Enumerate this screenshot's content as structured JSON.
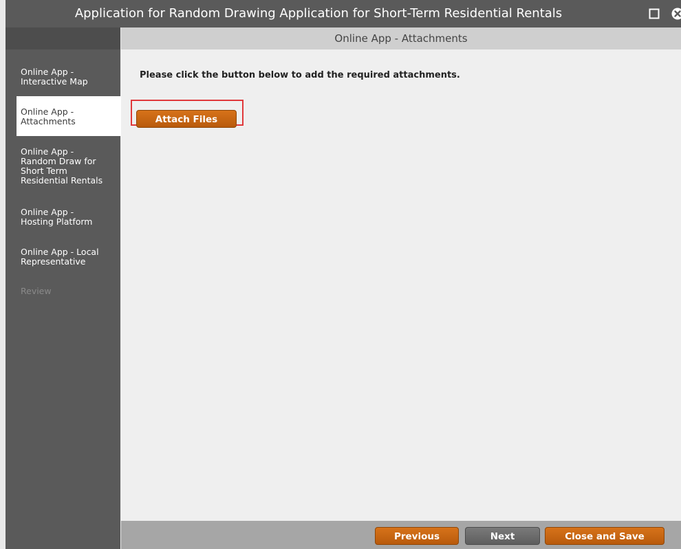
{
  "window": {
    "title": "Application for Random Drawing Application for Short-Term Residential Rentals"
  },
  "sidebar": {
    "items": [
      {
        "lines": [
          "Online App -",
          "Interactive Map"
        ],
        "state": "normal"
      },
      {
        "lines": [
          "Online App -",
          "Attachments"
        ],
        "state": "active"
      },
      {
        "lines": [
          "Online App -",
          "Random Draw for",
          "Short Term",
          "Residential Rentals"
        ],
        "state": "normal"
      },
      {
        "lines": [
          "Online App -",
          "Hosting Platform"
        ],
        "state": "normal"
      },
      {
        "lines": [
          "Online App - Local",
          "Representative"
        ],
        "state": "normal"
      },
      {
        "lines": [
          "Review"
        ],
        "state": "disabled"
      }
    ]
  },
  "main": {
    "header": "Online App - Attachments",
    "instructions": "Please click the button below to add the required attachments.",
    "attach_button": "Attach Files"
  },
  "footer": {
    "previous": "Previous",
    "next": "Next",
    "close_save": "Close and Save"
  },
  "colors": {
    "accent_orange": "#c8650f",
    "highlight_red": "#e0383a",
    "sidebar_bg": "#5a5a5a"
  },
  "icons": {
    "maximize": "maximize-icon",
    "close": "close-icon"
  }
}
